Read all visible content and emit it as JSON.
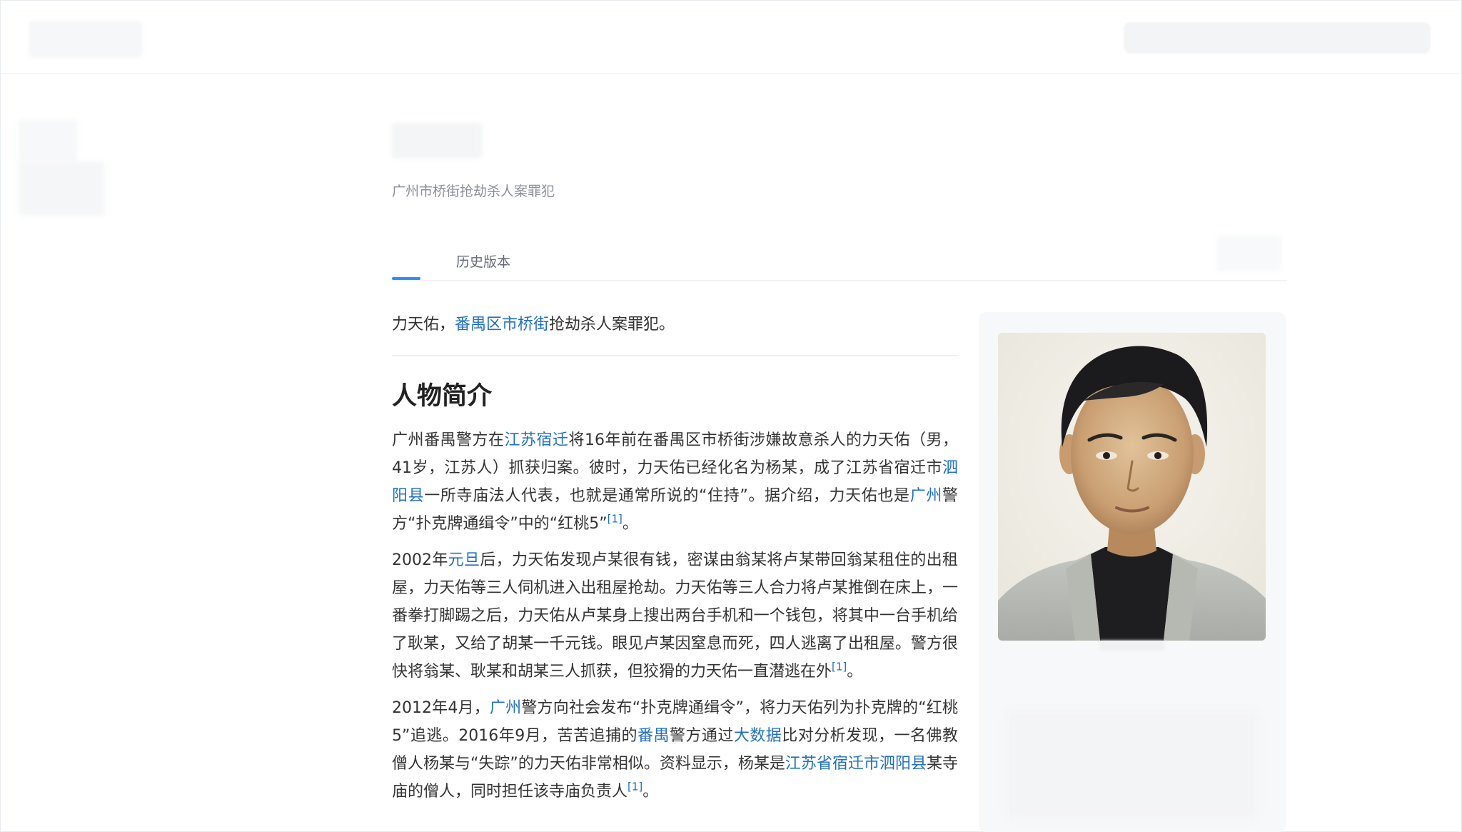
{
  "page": {
    "subtitle": "广州市桥街抢劫杀人案罪犯"
  },
  "tabs": {
    "history_label": "历史版本"
  },
  "article": {
    "lead": {
      "t1": "力天佑，",
      "link1": "番禺区",
      "link2": "市桥街",
      "t2": "抢劫杀人案罪犯。"
    },
    "section_title": "人物简介",
    "p1": {
      "t1": "广州番禺警方在",
      "link1": "江苏宿迁",
      "t2": "将16年前在番禺区市桥街涉嫌故意杀人的力天佑（男，41岁，江苏人）抓获归案。彼时，力天佑已经化名为杨某，成了江苏省宿迁市",
      "link2": "泗阳县",
      "t3": "一所寺庙法人代表，也就是通常所说的“住持”。据介绍，力天佑也是",
      "link3": "广州",
      "t4": "警方“扑克牌通缉令”中的“红桃5”",
      "ref": "[1]",
      "t5": "。"
    },
    "p2": {
      "t1": "2002年",
      "link1": "元旦",
      "t2": "后，力天佑发现卢某很有钱，密谋由翁某将卢某带回翁某租住的出租屋，力天佑等三人伺机进入出租屋抢劫。力天佑等三人合力将卢某推倒在床上，一番拳打脚踢之后，力天佑从卢某身上搜出两台手机和一个钱包，将其中一台手机给了耿某，又给了胡某一千元钱。眼见卢某因窒息而死，四人逃离了出租屋。警方很快将翁某、耿某和胡某三人抓获，但狡猾的力天佑一直潜逃在外",
      "ref": "[1]",
      "t3": "。"
    },
    "p3": {
      "t1": "2012年4月，",
      "link1": "广州",
      "t2": "警方向社会发布“扑克牌通缉令”，将力天佑列为扑克牌的“红桃5”追逃。2016年9月，苦苦追捕的",
      "link2": "番禺",
      "t3": "警方通过",
      "link3": "大数据",
      "t4": "比对分析发现，一名佛教僧人杨某与“失踪”的力天佑非常相似。资料显示，杨某是",
      "link4": "江苏省宿迁市泗阳县",
      "t5": "某寺庙的僧人，同时担任该寺庙负责人",
      "ref": "[1]",
      "t6": "。"
    }
  },
  "colors": {
    "link": "#1f6fc1",
    "tab_active": "#2e90f0"
  }
}
